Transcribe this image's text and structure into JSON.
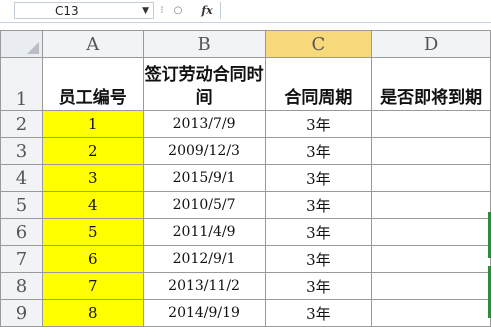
{
  "formula_bar": {
    "name_box": "C13",
    "fx_label": "fx",
    "formula": ""
  },
  "columns": [
    "A",
    "B",
    "C",
    "D"
  ],
  "selected_column": "C",
  "header_row": {
    "row_number": "1",
    "A": "员工编号",
    "B": "签订劳动合同时间",
    "C": "合同周期",
    "D": "是否即将到期"
  },
  "rows": [
    {
      "row": "2",
      "A": "1",
      "B": "2013/7/9",
      "C": "3年",
      "D": ""
    },
    {
      "row": "3",
      "A": "2",
      "B": "2009/12/3",
      "C": "3年",
      "D": ""
    },
    {
      "row": "4",
      "A": "3",
      "B": "2015/9/1",
      "C": "3年",
      "D": ""
    },
    {
      "row": "5",
      "A": "4",
      "B": "2010/5/7",
      "C": "3年",
      "D": ""
    },
    {
      "row": "6",
      "A": "5",
      "B": "2011/4/9",
      "C": "3年",
      "D": ""
    },
    {
      "row": "7",
      "A": "6",
      "B": "2012/9/1",
      "C": "3年",
      "D": ""
    },
    {
      "row": "8",
      "A": "7",
      "B": "2013/11/2",
      "C": "3年",
      "D": ""
    },
    {
      "row": "9",
      "A": "8",
      "B": "2014/9/19",
      "C": "3年",
      "D": ""
    }
  ],
  "colors": {
    "highlight": "#ffff00",
    "selected_header": "#f7d97c",
    "header_bg": "#f1f3f6",
    "grid_line": "#9a9a9a",
    "edge_mark": "#2e8b3b"
  }
}
